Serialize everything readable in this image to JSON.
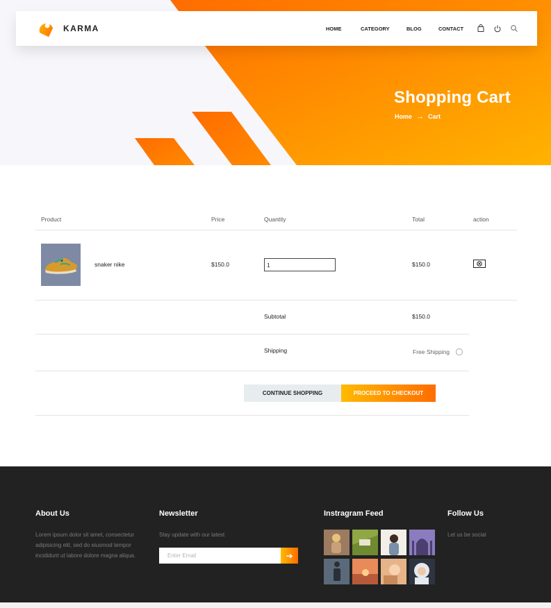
{
  "header": {
    "brand": "KARMA",
    "nav": [
      "HOME",
      "CATEGORY",
      "BLOG",
      "CONTACT"
    ],
    "icons": [
      "shopping-bag-icon",
      "power-icon",
      "search-icon"
    ]
  },
  "hero": {
    "title": "Shopping Cart",
    "breadcrumb": [
      "Home",
      "Cart"
    ],
    "colors": {
      "start": "#ff6c00",
      "end": "#ffb300"
    }
  },
  "cart": {
    "columns": [
      "Product",
      "Price",
      "Quantity",
      "Total",
      "action"
    ],
    "items": [
      {
        "name": "snaker nike",
        "price": "$150.0",
        "quantity": "1",
        "total": "$150.0"
      }
    ],
    "subtotal_label": "Subtotal",
    "subtotal_value": "$150.0",
    "shipping_label": "Shipping",
    "shipping_option": "Free Shipping",
    "continue_label": "CONTINUE SHOPPING",
    "checkout_label": "PROCEED TO CHECKOUT"
  },
  "footer": {
    "about_title": "About Us",
    "about_text": "Lorem ipsum dolor sit amet, consectetur adipisicing elit, sed do eiusmod tempor incididunt ut labore dolore magna aliqua.",
    "newsletter_title": "Newsletter",
    "newsletter_text": "Stay update with our latest",
    "email_placeholder": "Enter Email",
    "instagram_title": "Instragram Feed",
    "follow_title": "Follow Us",
    "follow_text": "Let us be social"
  }
}
